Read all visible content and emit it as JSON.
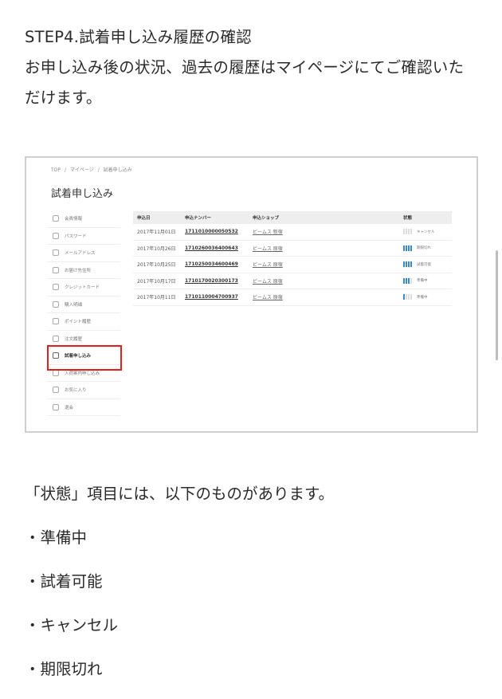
{
  "intro": {
    "line1": "STEP4.試着申し込み履歴の確認",
    "line2": "お申し込み後の状況、過去の履歴はマイページにてご確認いた",
    "line3": "だけます。"
  },
  "screenshot": {
    "breadcrumb": [
      "TOP",
      "マイページ",
      "試着申し込み"
    ],
    "title": "試着申し込み",
    "sidebar": [
      {
        "label": "会員情報",
        "icon": "user-icon"
      },
      {
        "label": "パスワード",
        "icon": "key-icon"
      },
      {
        "label": "メールアドレス",
        "icon": "mail-at-icon"
      },
      {
        "label": "お届け先住所",
        "icon": "location-icon"
      },
      {
        "label": "クレジットカード",
        "icon": "card-icon"
      },
      {
        "label": "購入明細",
        "icon": "receipt-icon"
      },
      {
        "label": "ポイント履歴",
        "icon": "point-icon"
      },
      {
        "label": "注文履歴",
        "icon": "history-icon"
      },
      {
        "label": "試着申し込み",
        "icon": "hanger-icon",
        "active": true
      },
      {
        "label": "入荷案内申し込み",
        "icon": "calendar-icon"
      },
      {
        "label": "お気に入り",
        "icon": "heart-icon"
      },
      {
        "label": "退会",
        "icon": "exit-icon"
      }
    ],
    "table": {
      "headers": [
        "申込日",
        "申込ナンバー",
        "申込ショップ",
        "状態"
      ],
      "rows": [
        {
          "date": "2017年11月01日",
          "number": "1711010000050532",
          "shop": "ビームス 新宿",
          "status": "キャンセル",
          "level": 0
        },
        {
          "date": "2017年10月26日",
          "number": "1710260036400643",
          "shop": "ビームス 原宿",
          "status": "期限切れ",
          "level": 4
        },
        {
          "date": "2017年10月25日",
          "number": "1710250034600469",
          "shop": "ビームス 原宿",
          "status": "試着可能",
          "level": 4
        },
        {
          "date": "2017年10月17日",
          "number": "1710170020300173",
          "shop": "ビームス 原宿",
          "status": "準備中",
          "level": 3
        },
        {
          "date": "2017年10月11日",
          "number": "1710110004700937",
          "shop": "ビームス 原宿",
          "status": "準備中",
          "level": 1
        }
      ]
    }
  },
  "outro": {
    "lead": "「状態」項目には、以下のものがあります。",
    "items": [
      "・準備中",
      "・試着可能",
      "・キャンセル",
      "・期限切れ"
    ]
  },
  "colors": {
    "highlight": "#e0201c",
    "status_bar_on": "#3a86c8",
    "status_bar_off": "#dddddd"
  }
}
